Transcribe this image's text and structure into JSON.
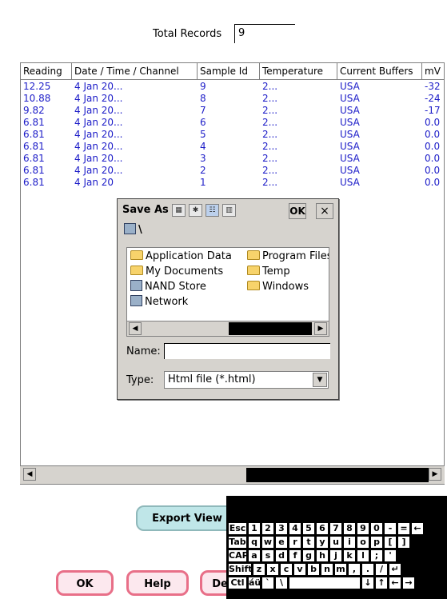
{
  "total_records": {
    "label": "Total Records",
    "value": "9"
  },
  "table": {
    "columns": [
      "Reading",
      "Date / Time / Channel",
      "Sample Id",
      "Temperature",
      "Current Buffers",
      "mV"
    ],
    "rows": [
      [
        "12.25",
        "4 Jan 20...",
        "9",
        "2...",
        "USA",
        "-32"
      ],
      [
        "10.88",
        "4 Jan 20...",
        "8",
        "2...",
        "USA",
        "-24"
      ],
      [
        "9.82",
        "4 Jan 20...",
        "7",
        "2...",
        "USA",
        "-17"
      ],
      [
        "6.81",
        "4 Jan 20...",
        "6",
        "2...",
        "USA",
        "0.0"
      ],
      [
        "6.81",
        "4 Jan 20...",
        "5",
        "2...",
        "USA",
        "0.0"
      ],
      [
        "6.81",
        "4 Jan 20...",
        "4",
        "2...",
        "USA",
        "0.0"
      ],
      [
        "6.81",
        "4 Jan 20...",
        "3",
        "2...",
        "USA",
        "0.0"
      ],
      [
        "6.81",
        "4 Jan 20...",
        "2",
        "2...",
        "USA",
        "0.0"
      ],
      [
        "6.81",
        "4 Jan 20",
        "1",
        "2...",
        "USA",
        "0.0"
      ]
    ]
  },
  "dialog": {
    "title": "Save As",
    "ok": "OK",
    "close": "×",
    "path": "\\",
    "items": [
      {
        "name": "Application Data",
        "icon": "folder-icon"
      },
      {
        "name": "Program Files",
        "icon": "folder-icon"
      },
      {
        "name": "My Documents",
        "icon": "folder-icon"
      },
      {
        "name": "Temp",
        "icon": "folder-icon"
      },
      {
        "name": "NAND Store",
        "icon": "storage-icon"
      },
      {
        "name": "Windows",
        "icon": "folder-icon"
      },
      {
        "name": "Network",
        "icon": "network-icon"
      }
    ],
    "name_label": "Name:",
    "name_value": "",
    "type_label": "Type:",
    "type_value": "Html file (*.html)"
  },
  "buttons": {
    "export_view": "Export View",
    "ok": "OK",
    "help": "Help",
    "de": "De"
  },
  "keyboard": {
    "rows": [
      [
        "Esc",
        "1",
        "2",
        "3",
        "4",
        "5",
        "6",
        "7",
        "8",
        "9",
        "0",
        "-",
        "=",
        "←"
      ],
      [
        "Tab",
        "q",
        "w",
        "e",
        "r",
        "t",
        "y",
        "u",
        "i",
        "o",
        "p",
        "[",
        "]"
      ],
      [
        "CAP",
        "a",
        "s",
        "d",
        "f",
        "g",
        "h",
        "j",
        "k",
        "l",
        ";",
        "'"
      ],
      [
        "Shift",
        "z",
        "x",
        "c",
        "v",
        "b",
        "n",
        "m",
        ",",
        ".",
        "/",
        "↵"
      ],
      [
        "Ctl",
        "áü",
        "`",
        "\\",
        "",
        "↓",
        "↑",
        "←",
        "→"
      ]
    ]
  }
}
